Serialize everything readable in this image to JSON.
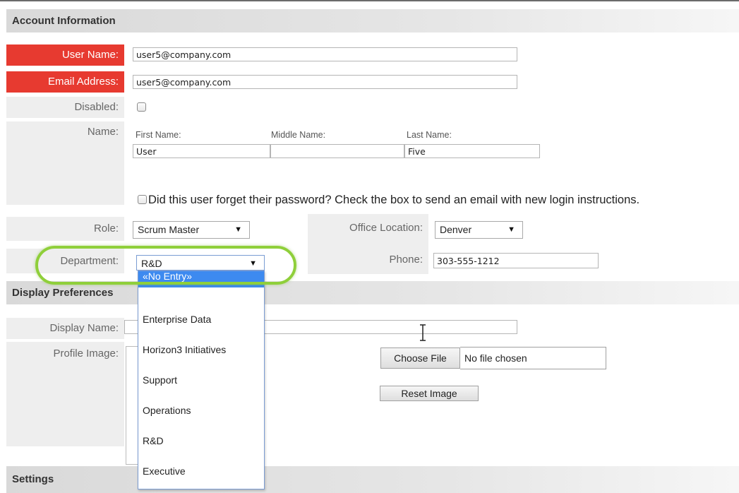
{
  "sections": {
    "account": "Account Information",
    "display": "Display Preferences",
    "settings": "Settings"
  },
  "labels": {
    "user_name": "User Name:",
    "email": "Email Address:",
    "disabled": "Disabled:",
    "name": "Name:",
    "role": "Role:",
    "department": "Department:",
    "office_location": "Office Location:",
    "phone": "Phone:",
    "display_name": "Display Name:",
    "profile_image": "Profile Image:"
  },
  "values": {
    "user_name": "user5@company.com",
    "email": "user5@company.com",
    "first_name": "User",
    "middle_name": "",
    "last_name": "Five",
    "role": "Scrum Master",
    "department": "R&D",
    "office_location": "Denver",
    "phone": "303-555-1212"
  },
  "sublabels": {
    "first": "First Name:",
    "middle": "Middle Name:",
    "last": "Last Name:"
  },
  "forgot_password": "Did this user forget their password? Check the box to send an email with new login instructions.",
  "buttons": {
    "choose_file": "Choose File",
    "no_file": "No file chosen",
    "reset_image": "Reset Image"
  },
  "department_options": [
    "«No Entry»",
    "Enterprise Data",
    "Horizon3 Initiatives",
    "Support",
    "Operations",
    "R&D",
    "Executive"
  ],
  "colors": {
    "required_label": "#e73a30",
    "highlight": "#8fcf3a",
    "dropdown_selected": "#3d8af0"
  }
}
